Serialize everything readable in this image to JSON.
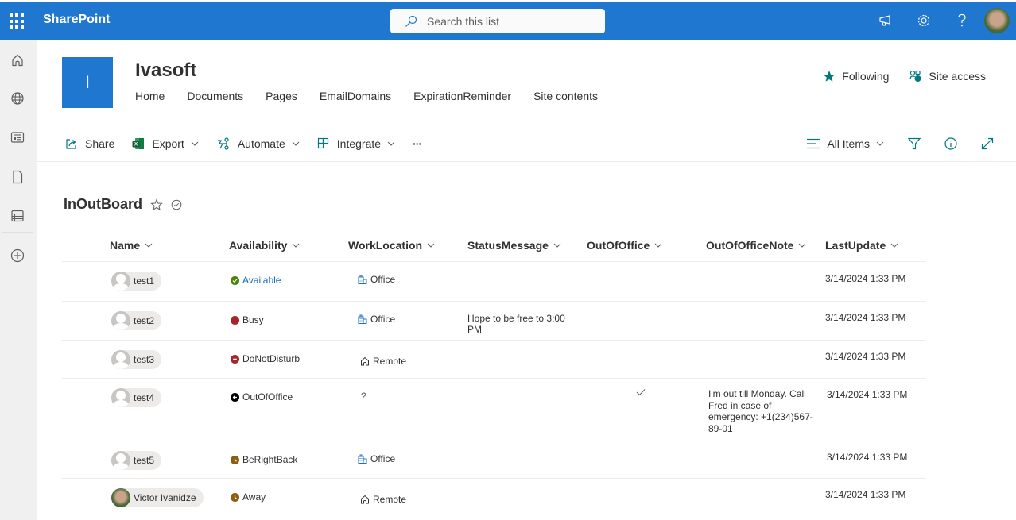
{
  "topbar": {
    "app_name": "SharePoint",
    "search_placeholder": "Search this list",
    "icons": [
      "waffle-icon",
      "megaphone-icon",
      "gear-icon",
      "help-icon",
      "user-avatar"
    ]
  },
  "leftrail": {
    "items": [
      {
        "name": "home",
        "icon": "home-icon"
      },
      {
        "name": "sites",
        "icon": "globe-icon"
      },
      {
        "name": "news",
        "icon": "news-icon"
      },
      {
        "name": "files",
        "icon": "file-icon"
      },
      {
        "name": "lists",
        "icon": "list-icon"
      },
      {
        "name": "create",
        "icon": "add-circle-icon"
      }
    ]
  },
  "site": {
    "logo_letter": "I",
    "title": "Ivasoft",
    "nav": [
      "Home",
      "Documents",
      "Pages",
      "EmailDomains",
      "ExpirationReminder",
      "Site contents"
    ],
    "following_label": "Following",
    "site_access_label": "Site access"
  },
  "commandbar": {
    "share": "Share",
    "export": "Export",
    "automate": "Automate",
    "integrate": "Integrate",
    "more": "···",
    "view": "All Items"
  },
  "list": {
    "title": "InOutBoard",
    "columns": [
      "Name",
      "Availability",
      "WorkLocation",
      "StatusMessage",
      "OutOfOffice",
      "OutOfOfficeNote",
      "LastUpdate"
    ],
    "rows": [
      {
        "name": "test1",
        "photo": false,
        "availability": "Available",
        "avail_color": "#498205",
        "avail_glyph": "check",
        "avail_text_color": "#0f6cbd",
        "location": "Office",
        "status": "",
        "ooo": false,
        "ooo_note": "",
        "last_update": "3/14/2024 1:33 PM"
      },
      {
        "name": "test2",
        "photo": false,
        "availability": "Busy",
        "avail_color": "#a4262c",
        "avail_glyph": "",
        "avail_text_color": "#323130",
        "location": "Office",
        "status": "Hope to be free to 3:00 PM",
        "ooo": false,
        "ooo_note": "",
        "last_update": "3/14/2024 1:33 PM"
      },
      {
        "name": "test3",
        "photo": false,
        "availability": "DoNotDisturb",
        "avail_color": "#a4262c",
        "avail_glyph": "minus",
        "avail_text_color": "#323130",
        "location": "Remote",
        "status": "",
        "ooo": false,
        "ooo_note": "",
        "last_update": "3/14/2024 1:33 PM"
      },
      {
        "name": "test4",
        "photo": false,
        "availability": "OutOfOffice",
        "avail_color": "#000000",
        "avail_glyph": "arrow",
        "avail_text_color": "#323130",
        "location": "?",
        "status": "",
        "ooo": true,
        "ooo_note": "I'm out till Monday. Call Fred in case of emergency: +1(234)567-89-01",
        "last_update": "3/14/2024 1:33 PM"
      },
      {
        "name": "test5",
        "photo": false,
        "availability": "BeRightBack",
        "avail_color": "#8a5f0f",
        "avail_glyph": "clock",
        "avail_text_color": "#323130",
        "location": "Office",
        "status": "",
        "ooo": false,
        "ooo_note": "",
        "last_update": "3/14/2024 1:33 PM"
      },
      {
        "name": "Victor Ivanidze",
        "photo": true,
        "availability": "Away",
        "avail_color": "#8a5f0f",
        "avail_glyph": "clock",
        "avail_text_color": "#323130",
        "location": "Remote",
        "status": "",
        "ooo": false,
        "ooo_note": "",
        "last_update": "3/14/2024 1:33 PM"
      }
    ]
  },
  "colors": {
    "brand_blue": "#1f77d0",
    "accent_teal": "#03787c"
  }
}
